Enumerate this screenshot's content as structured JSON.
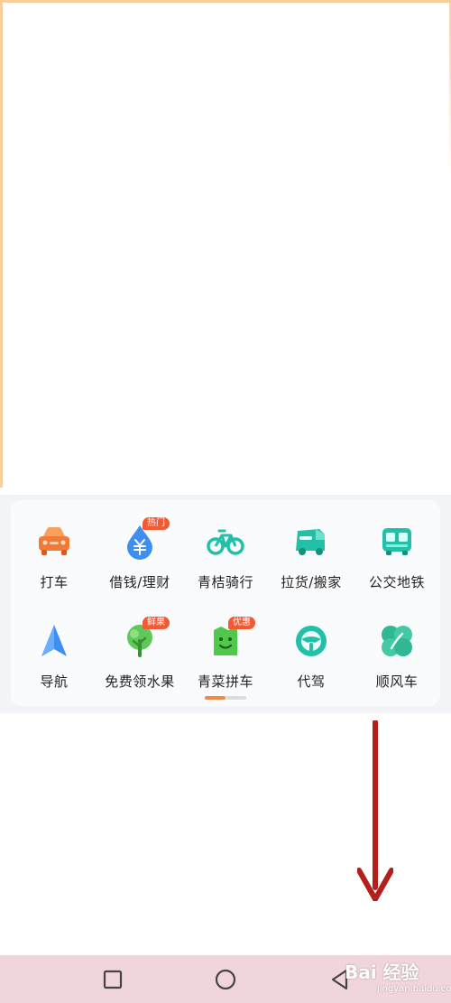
{
  "services": {
    "items": [
      {
        "label": "打车",
        "icon": "car-icon",
        "badge": null
      },
      {
        "label": "借钱/理财",
        "icon": "money-drop-icon",
        "badge": "热门"
      },
      {
        "label": "青桔骑行",
        "icon": "bicycle-icon",
        "badge": null
      },
      {
        "label": "拉货/搬家",
        "icon": "truck-icon",
        "badge": null
      },
      {
        "label": "公交地铁",
        "icon": "bus-icon",
        "badge": null
      },
      {
        "label": "导航",
        "icon": "navigation-arrow-icon",
        "badge": null
      },
      {
        "label": "免费领水果",
        "icon": "tree-icon",
        "badge": "鲜果"
      },
      {
        "label": "青菜拼车",
        "icon": "smiley-bag-icon",
        "badge": "优惠"
      },
      {
        "label": "代驾",
        "icon": "steering-wheel-icon",
        "badge": null
      },
      {
        "label": "顺风车",
        "icon": "leaf-clover-icon",
        "badge": null
      }
    ],
    "page_indicator": {
      "current": 1,
      "total": 2
    }
  },
  "watermark": {
    "text": "Bai 经验",
    "sub": "jingyan.baidu.com"
  },
  "colors": {
    "accent_orange": "#f08a4b",
    "badge_red": "#f25a33",
    "teal": "#22c0a8",
    "arrow_red": "#b3201c",
    "nav_bar": "#f0d6db"
  }
}
